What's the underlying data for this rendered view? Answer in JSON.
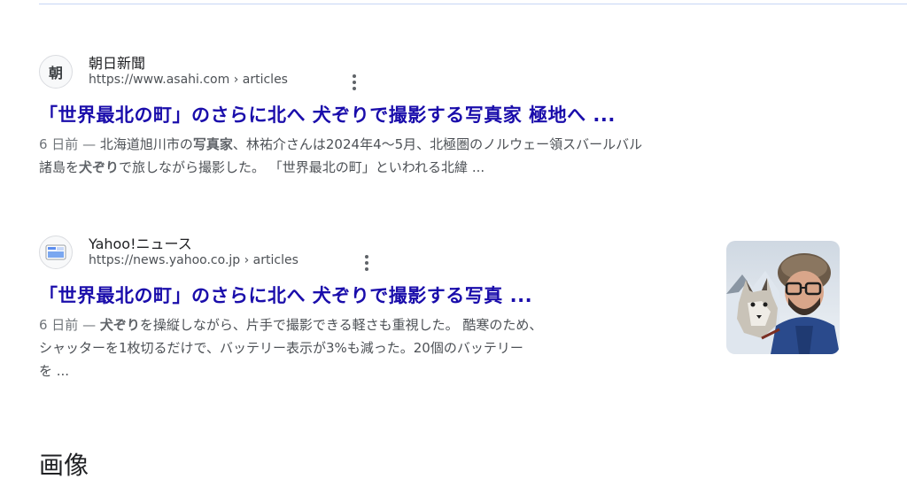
{
  "results": [
    {
      "site_name": "朝日新聞",
      "favicon_text": "朝",
      "url": "https://www.asahi.com › articles",
      "title": "「世界最北の町」のさらに北へ 犬ぞりで撮影する写真家 極地へ ...",
      "snippet_line1_date": "6 日前 —",
      "snippet_line1_a": " 北海道旭川市の",
      "snippet_line1_bold": "写真家",
      "snippet_line1_b": "、林祐介さんは2024年4〜5月、北極圏のノルウェー領スバールバル",
      "snippet_line2_a": "諸島を",
      "snippet_line2_bold": "犬ぞり",
      "snippet_line2_b": "で旅しながら撮影した。 「世界最北の町」といわれる北緯 ..."
    },
    {
      "site_name": "Yahoo!ニュース",
      "url": "https://news.yahoo.co.jp › articles",
      "title": "「世界最北の町」のさらに北へ 犬ぞりで撮影する写真 ...",
      "snippet_line1_date": "6 日前 —",
      "snippet_line1_bold": "犬ぞり",
      "snippet_line1_b": "を操縦しながら、片手で撮影できる軽さも重視した。 酷寒のため、",
      "snippet_line2": "シャッターを1枚切るだけで、バッテリー表示が3%も減った。20個のバッテリー",
      "snippet_line3": "を ..."
    }
  ],
  "section_heading": "画像",
  "icons": {
    "more": "more-vert-icon",
    "thumbnail": "photographer-with-sled-dog-thumbnail"
  },
  "colors": {
    "link": "#1a0dab",
    "snippet": "#4d5156",
    "divider": "#c7d6f5"
  }
}
